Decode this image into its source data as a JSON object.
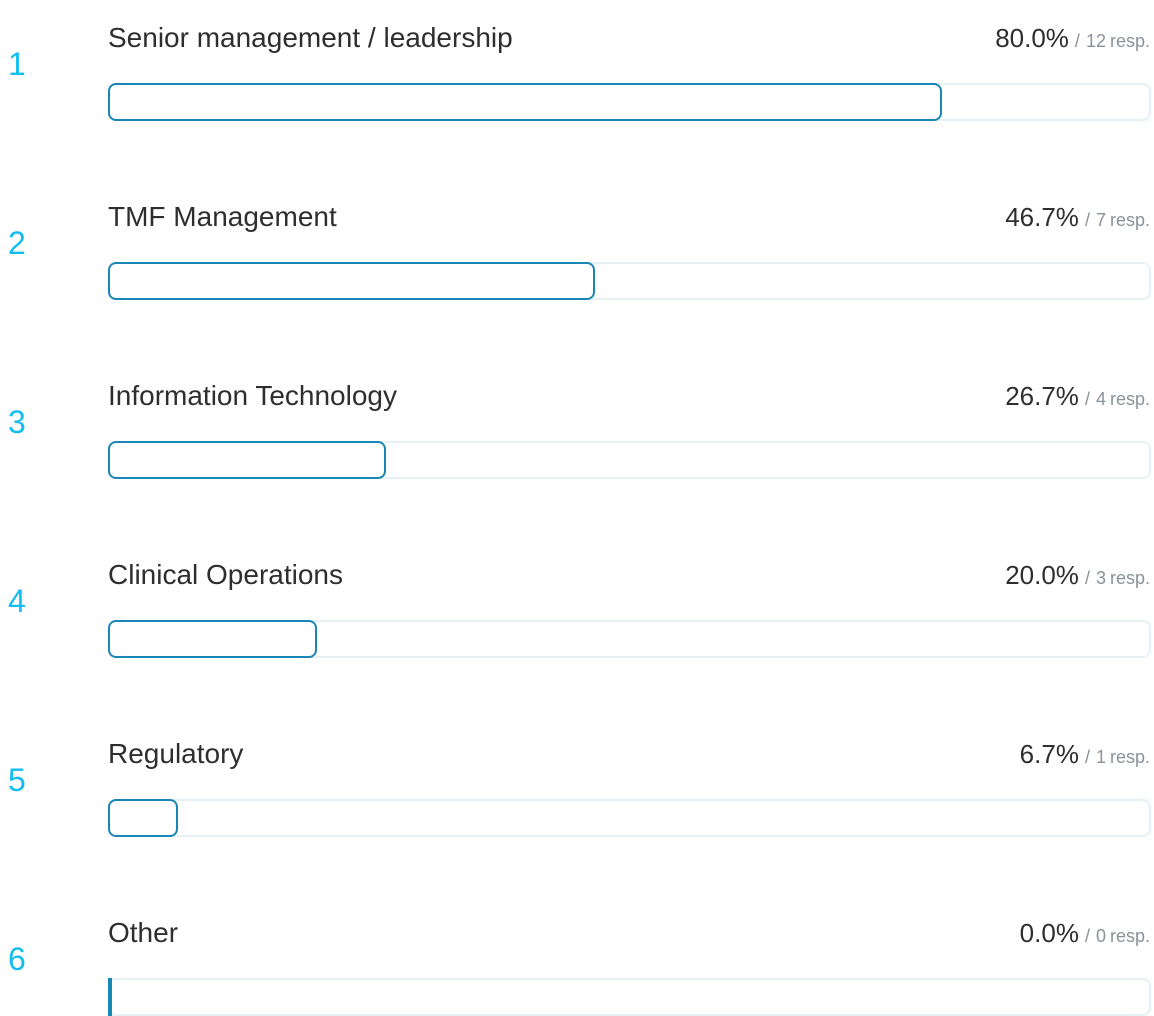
{
  "chart_data": {
    "type": "bar",
    "orientation": "horizontal",
    "categories": [
      "Senior management / leadership",
      "TMF Management",
      "Information Technology",
      "Clinical Operations",
      "Regulatory",
      "Other"
    ],
    "values": [
      80.0,
      46.7,
      26.7,
      20.0,
      6.7,
      0.0
    ],
    "xlim": [
      0,
      100
    ],
    "grid": false,
    "legend": "none",
    "colors": {
      "rank": "#13bdf0",
      "bar_outline": "#1a86b5",
      "track_outline": "#e6f1f6",
      "text": "#2e2e2e",
      "muted_text": "#8a9299"
    },
    "resp_separator": "/",
    "resp_unit": "resp.",
    "rows": [
      {
        "rank": "1",
        "label": "Senior management / leadership",
        "percent_label": "80.0%",
        "responses": "12",
        "value": 80.0
      },
      {
        "rank": "2",
        "label": "TMF Management",
        "percent_label": "46.7%",
        "responses": "7",
        "value": 46.7
      },
      {
        "rank": "3",
        "label": "Information Technology",
        "percent_label": "26.7%",
        "responses": "4",
        "value": 26.7
      },
      {
        "rank": "4",
        "label": "Clinical Operations",
        "percent_label": "20.0%",
        "responses": "3",
        "value": 20.0
      },
      {
        "rank": "5",
        "label": "Regulatory",
        "percent_label": "6.7%",
        "responses": "1",
        "value": 6.7
      },
      {
        "rank": "6",
        "label": "Other",
        "percent_label": "0.0%",
        "responses": "0",
        "value": 0.0
      }
    ]
  }
}
